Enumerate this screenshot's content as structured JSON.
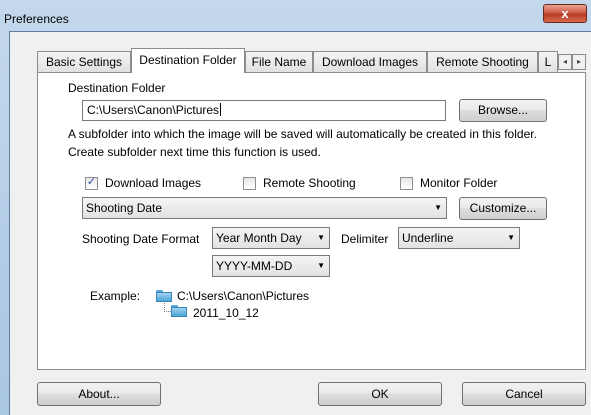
{
  "window": {
    "title": "Preferences",
    "close_glyph": "x"
  },
  "tabs": [
    {
      "label": "Basic Settings",
      "active": false
    },
    {
      "label": "Destination Folder",
      "active": true
    },
    {
      "label": "File Name",
      "active": false
    },
    {
      "label": "Download Images",
      "active": false
    },
    {
      "label": "Remote Shooting",
      "active": false
    },
    {
      "label": "L",
      "active": false
    }
  ],
  "tab_scroll": {
    "left": "◂",
    "right": "▸"
  },
  "destination": {
    "label": "Destination Folder",
    "path": "C:\\Users\\Canon\\Pictures",
    "browse_label": "Browse..."
  },
  "description": {
    "line1": "A subfolder into which the image will be saved will automatically be created in this folder.",
    "line2": "Create subfolder next time this function is used."
  },
  "options": {
    "download_images": {
      "label": "Download Images",
      "checked": true,
      "mark": "✓"
    },
    "remote_shooting": {
      "label": "Remote Shooting",
      "checked": false
    },
    "monitor_folder": {
      "label": "Monitor Folder",
      "checked": false
    }
  },
  "subfolder_rule": {
    "value": "Shooting Date",
    "customize_label": "Customize..."
  },
  "date_format": {
    "label": "Shooting Date Format",
    "order": "Year Month Day",
    "delimiter_label": "Delimiter",
    "delimiter": "Underline",
    "pattern": "YYYY-MM-DD"
  },
  "example": {
    "label": "Example:",
    "root": "C:\\Users\\Canon\\Pictures",
    "subfolder": "2011_10_12"
  },
  "footer": {
    "about_label": "About...",
    "ok_label": "OK",
    "cancel_label": "Cancel"
  },
  "icons": {
    "folder": "folder-icon",
    "dropdown": "chevron-down-icon",
    "check": "check-icon"
  },
  "colors": {
    "title_bar": "#b9d1ea",
    "close_button": "#c9553f",
    "folder": "#4fa3d9"
  }
}
